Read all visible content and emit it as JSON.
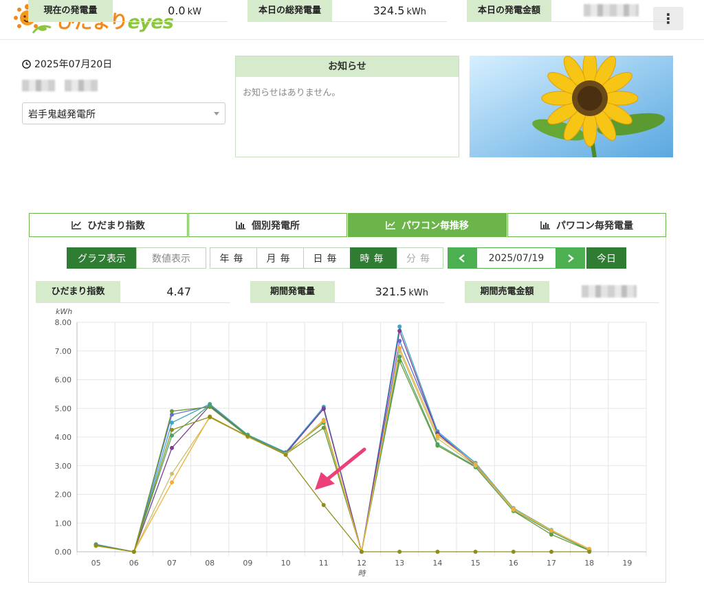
{
  "header": {
    "brand_jp": "ひだまり",
    "brand_en": "eyes",
    "menu_icon": "⋮"
  },
  "info": {
    "date": "2025年07月20日",
    "plant_selected": "岩手鬼越発電所"
  },
  "notice": {
    "title": "お知らせ",
    "body": "お知らせはありません。"
  },
  "summary": {
    "current_label": "現在の発電量",
    "current_value": "0.0",
    "current_unit": "kW",
    "today_total_label": "本日の総発電量",
    "today_total_value": "324.5",
    "today_total_unit": "kWh",
    "today_amount_label": "本日の発電金額"
  },
  "tabs": [
    {
      "label": "ひだまり指数",
      "icon": "line-chart-icon"
    },
    {
      "label": "個別発電所",
      "icon": "bar-chart-icon"
    },
    {
      "label": "パワコン毎推移",
      "icon": "line-chart-icon"
    },
    {
      "label": "パワコン毎発電量",
      "icon": "bar-chart-icon"
    }
  ],
  "controls": {
    "graph_view": "グラフ表示",
    "table_view": "数値表示",
    "periods": [
      "年毎",
      "月毎",
      "日毎",
      "時毎",
      "分毎"
    ],
    "date": "2025/07/19",
    "today": "今日"
  },
  "period_stats": {
    "index_label": "ひだまり指数",
    "index_value": "4.47",
    "energy_label": "期間発電量",
    "energy_value": "321.5",
    "energy_unit": "kWh",
    "sales_label": "期間売電金額"
  },
  "colors": {
    "accent": "#6bb54a",
    "dark": "#2e7d32",
    "label_bg": "#d6ebcc",
    "arrow": "#ec407a"
  },
  "chart_data": {
    "type": "line",
    "ylabel": "kWh",
    "xlabel": "時",
    "categories": [
      "05",
      "06",
      "07",
      "08",
      "09",
      "10",
      "11",
      "12",
      "13",
      "14",
      "15",
      "16",
      "17",
      "18",
      "19"
    ],
    "ylim": [
      0,
      8
    ],
    "yticks": [
      "0.00",
      "1.00",
      "2.00",
      "3.00",
      "4.00",
      "5.00",
      "6.00",
      "7.00",
      "8.00"
    ],
    "grid": true,
    "series": [
      {
        "color": "#3aa7c9",
        "values": [
          0.26,
          0.0,
          4.5,
          5.15,
          4.08,
          3.47,
          5.05,
          0.0,
          7.85,
          4.2,
          3.1,
          1.52,
          0.76,
          0.06,
          null
        ]
      },
      {
        "color": "#5b6fd6",
        "values": [
          0.25,
          0.0,
          4.78,
          5.08,
          4.05,
          3.45,
          5.0,
          0.0,
          7.35,
          4.15,
          3.05,
          1.5,
          0.74,
          0.05,
          null
        ]
      },
      {
        "color": "#7b3f8f",
        "values": [
          0.23,
          0.0,
          3.62,
          5.1,
          4.05,
          3.42,
          4.98,
          0.0,
          7.7,
          4.12,
          3.02,
          1.48,
          0.72,
          0.05,
          null
        ]
      },
      {
        "color": "#6a9a3a",
        "values": [
          0.22,
          0.0,
          4.9,
          5.05,
          4.02,
          3.4,
          4.32,
          0.0,
          6.65,
          3.7,
          2.95,
          1.42,
          0.6,
          0.04,
          null
        ]
      },
      {
        "color": "#4aa46a",
        "values": [
          0.24,
          0.0,
          4.05,
          5.12,
          4.06,
          3.44,
          4.5,
          0.0,
          6.8,
          3.75,
          2.98,
          1.44,
          0.7,
          0.05,
          null
        ]
      },
      {
        "color": "#c8c070",
        "values": [
          0.21,
          0.0,
          2.72,
          4.68,
          4.0,
          3.38,
          4.6,
          0.0,
          7.0,
          3.95,
          3.0,
          1.46,
          0.73,
          0.08,
          null
        ]
      },
      {
        "color": "#f0b030",
        "values": [
          0.2,
          0.0,
          2.42,
          4.72,
          4.02,
          3.4,
          4.55,
          0.0,
          7.1,
          4.05,
          3.06,
          1.5,
          0.75,
          0.1,
          null
        ]
      },
      {
        "color": "#8f8c1a",
        "values": [
          0.22,
          0.0,
          4.25,
          4.7,
          4.03,
          3.38,
          1.63,
          0.0,
          0.0,
          0.0,
          0.0,
          0.0,
          0.0,
          0.0,
          null
        ]
      }
    ]
  }
}
